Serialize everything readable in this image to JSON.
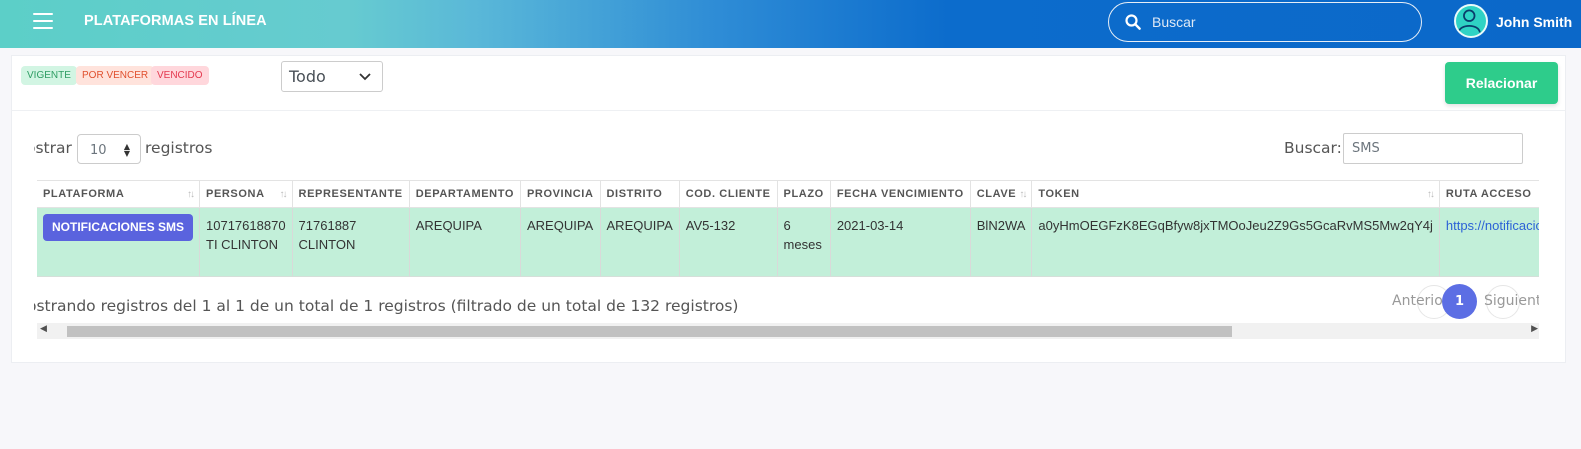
{
  "header": {
    "title": "PLATAFORMAS EN LÍNEA",
    "search_placeholder": "Buscar",
    "user_name": "John Smith"
  },
  "filters": {
    "badges": [
      "VIGENTE",
      "POR VENCER",
      "VENCIDO"
    ],
    "status_select_value": "Todo",
    "relacionar_label": "Relacionar"
  },
  "table_controls": {
    "length_label_before": "ostrar",
    "length_value": "10",
    "length_label_after": "registros",
    "search_label": "Buscar:",
    "search_value": "SMS"
  },
  "table": {
    "columns": [
      "PLATAFORMA",
      "PERSONA",
      "REPRESENTANTE",
      "DEPARTAMENTO",
      "PROVINCIA",
      "DISTRITO",
      "COD. CLIENTE",
      "PLAZO",
      "FECHA VENCIMIENTO",
      "CLAVE",
      "TOKEN",
      "RUTA ACCESO"
    ],
    "rows": [
      {
        "plataforma": "NOTIFICACIONES SMS",
        "persona_1": "10717618870",
        "persona_2": "TI CLINTON",
        "representante_1": "71761887",
        "representante_2": "CLINTON",
        "departamento": "AREQUIPA",
        "provincia": "AREQUIPA",
        "distrito": "AREQUIPA",
        "cod_cliente": "AV5-132",
        "plazo_1": "6",
        "plazo_2": "meses",
        "fecha_vencimiento": "2021-03-14",
        "clave": "BlN2WA",
        "token": "a0yHmOEGFzK8EGqBfyw8jxTMOoJeu2Z9Gs5GcaRvMS5Mw2qY4j",
        "ruta_acceso": "https://notificacion.clintontapia.com/"
      }
    ]
  },
  "footer": {
    "info": "ostrando registros del 1 al 1 de un total de 1 registros (filtrado de un total de 132 registros)",
    "prev_label": "Anterior",
    "current_page": "1",
    "next_label": "Siguiente"
  },
  "colors": {
    "accent_green": "#2ecc8b",
    "row_highlight": "#c2efd9",
    "pagination_active": "#5c6ee4",
    "platform_button": "#5a63de"
  }
}
